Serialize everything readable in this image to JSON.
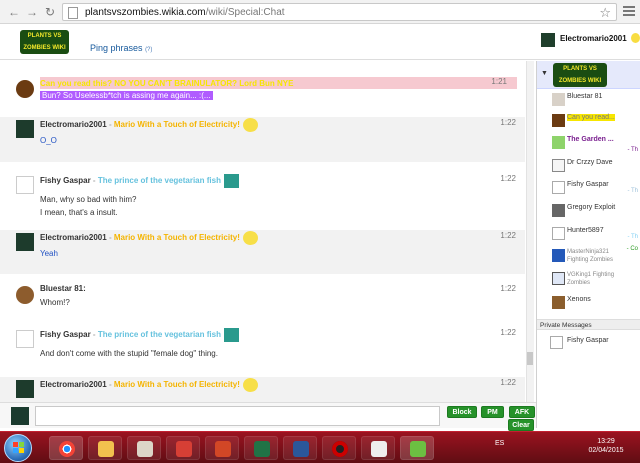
{
  "browser": {
    "url_domain": "plantsvszombies.wikia.com",
    "url_path": "/wiki/Special:Chat"
  },
  "chat": {
    "logo_text": "PLANTS VS ZOMBIES WIKI",
    "ping_phrases": "Ping phrases",
    "ping_help": "(?)",
    "current_user": "Electromario2001"
  },
  "messages": [
    {
      "time": "1:21",
      "line1": "Can you read this? NO YOU CAN'T BRAINULATOR? Lord Bun NYE",
      "line2": "Bun? So Uselessb*tch is assing me again... :(..."
    },
    {
      "name": "Electromario2001",
      "tag": "Mario With a Touch of Electricity!",
      "time": "1:22",
      "text": "O_O"
    },
    {
      "name": "Fishy Gaspar",
      "tag": "The prince of the vegetarian fish",
      "time": "1:22",
      "text1": "Man, why so bad with him?",
      "text2": "I mean, that's a insult."
    },
    {
      "name": "Electromario2001",
      "tag": "Mario With a Touch of Electricity!",
      "time": "1:22",
      "text": "Yeah"
    },
    {
      "name": "Bluestar 81:",
      "time": "1:22",
      "text": "Whom!?"
    },
    {
      "name": "Fishy Gaspar",
      "tag": "The prince of the vegetarian fish",
      "time": "1:22",
      "text": "And don't come with the stupid \"female dog\" thing."
    },
    {
      "name": "Electromario2001",
      "tag": "Mario With a Touch of Electricity!",
      "time": "1:22"
    }
  ],
  "sidebar": {
    "users": [
      {
        "name": "Bluestar 81"
      },
      {
        "name": "Can you read...",
        "right": ""
      },
      {
        "name": "The Garden ...",
        "right": "- Th"
      },
      {
        "name": "Dr Crzzy Dave"
      },
      {
        "name": "Fishy Gaspar",
        "right": "- Th"
      },
      {
        "name": "Gregory Exploit"
      },
      {
        "name": "Hunter5897",
        "right": "- Th"
      },
      {
        "name": "MasterNinja321 Fighting Zombies",
        "right": "- Co"
      },
      {
        "name": "VGKing1 Fighting Zombies"
      },
      {
        "name": "Xenons"
      }
    ],
    "private_heading": "Private Messages",
    "private_user": "Fishy Gaspar"
  },
  "input": {
    "value": "",
    "block": "Block",
    "pm": "PM",
    "afk": "AFK",
    "clear": "Clear"
  },
  "taskbar": {
    "lang": "ES",
    "time": "13:29",
    "date": "02/04/2015"
  }
}
